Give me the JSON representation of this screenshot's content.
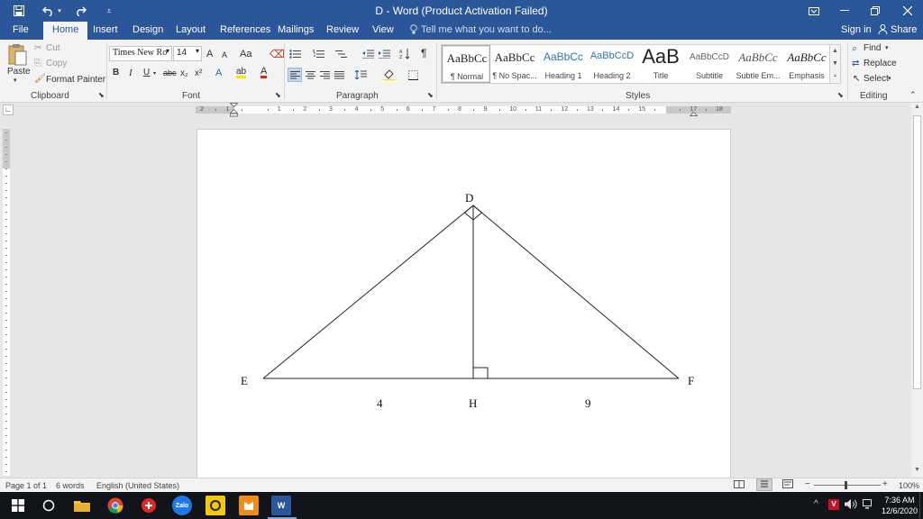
{
  "window": {
    "title": "D - Word (Product Activation Failed)",
    "save_icon": "save-icon",
    "undo_icon": "undo-icon",
    "redo_icon": "redo-icon",
    "customize_icon": "customize-qat-icon"
  },
  "tabs": [
    "File",
    "Home",
    "Insert",
    "Design",
    "Layout",
    "References",
    "Mailings",
    "Review",
    "View"
  ],
  "active_tab": "Home",
  "tell_me": "Tell me what you want to do...",
  "account": {
    "sign_in": "Sign in",
    "share": "Share"
  },
  "clipboard": {
    "paste": "Paste",
    "cut": "Cut",
    "copy": "Copy",
    "format_painter": "Format Painter",
    "label": "Clipboard"
  },
  "font": {
    "name": "Times New Ro",
    "size": "14",
    "label": "Font",
    "grow": "A",
    "shrink": "A",
    "change_case": "Aa",
    "bold": "B",
    "italic": "I",
    "underline": "U",
    "strikethrough": "abc",
    "subscript": "x₂",
    "superscript": "x²",
    "text_effects": "A",
    "highlight": "ab",
    "font_color": "A"
  },
  "paragraph": {
    "label": "Paragraph",
    "show_marks": "¶"
  },
  "styles": {
    "label": "Styles",
    "items": [
      {
        "preview": "AaBbCс",
        "name": "¶ Normal"
      },
      {
        "preview": "AaBbCс",
        "name": "¶ No Spac..."
      },
      {
        "preview": "AaBbCс",
        "name": "Heading 1"
      },
      {
        "preview": "AaBbCcD",
        "name": "Heading 2"
      },
      {
        "preview": "AaB",
        "name": "Title"
      },
      {
        "preview": "AaBbCcD",
        "name": "Subtitle"
      },
      {
        "preview": "AaBbCс",
        "name": "Subtle Em..."
      },
      {
        "preview": "AaBbCс",
        "name": "Emphasis"
      }
    ]
  },
  "editing": {
    "label": "Editing",
    "find": "Find",
    "replace": "Replace",
    "select": "Select"
  },
  "ruler": {
    "numbers": [
      "2",
      "1",
      "",
      "1",
      "2",
      "3",
      "4",
      "5",
      "6",
      "7",
      "8",
      "9",
      "10",
      "11",
      "12",
      "13",
      "14",
      "15",
      "",
      "17",
      "18"
    ]
  },
  "figure": {
    "vertex_labels": {
      "D": "D",
      "E": "E",
      "F": "F",
      "H": "H"
    },
    "segment_labels": {
      "EH": "4",
      "HF": "9"
    }
  },
  "status": {
    "page": "Page 1 of 1",
    "words": "6 words",
    "language": "English (United States)",
    "zoom": "100%"
  },
  "taskbar": {
    "time": "7:36 AM",
    "date": "12/6/2020",
    "apps": [
      "windows-start",
      "cortana",
      "file-explorer",
      "chrome",
      "garena",
      "zalo",
      "pdf-reader",
      "fox-app",
      "word"
    ]
  },
  "colors": {
    "accent": "#2b579a"
  }
}
